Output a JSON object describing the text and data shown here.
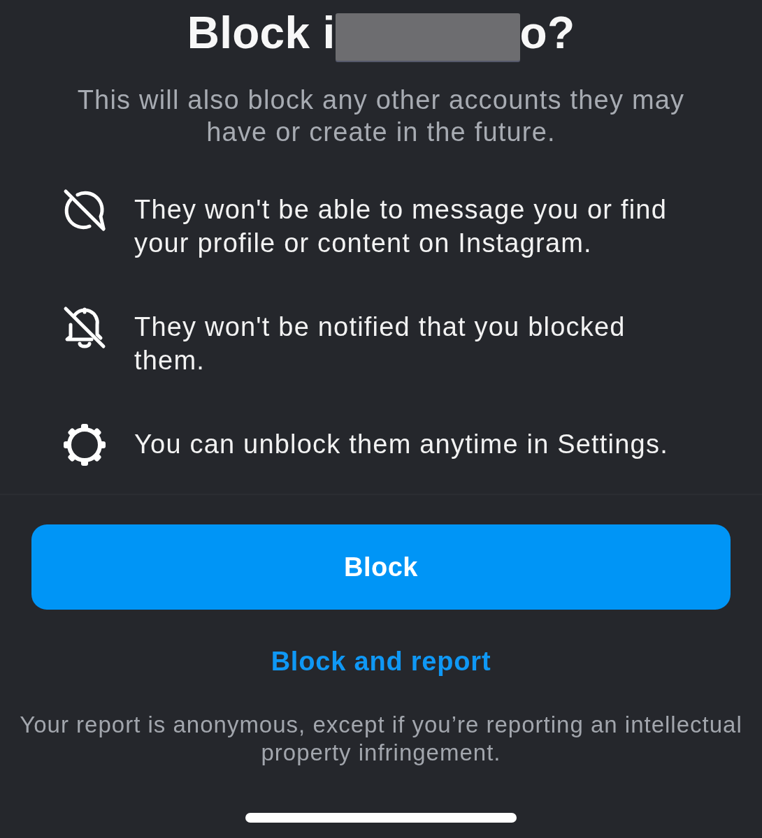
{
  "title": {
    "start": "Block i",
    "end": "o?",
    "redacted": true
  },
  "subtitle": "This will also block any other accounts they may have or create in the future.",
  "points": [
    {
      "text": "They won't be able to message you or find your profile or content on Instagram."
    },
    {
      "text": "They won't be notified that you blocked them."
    },
    {
      "text": "You can unblock them anytime in Settings."
    }
  ],
  "primary_button": {
    "label": "Block"
  },
  "secondary_link": {
    "label": "Block and report"
  },
  "footnote": "Your report is anonymous, except if you’re reporting an intellectual property infringement."
}
